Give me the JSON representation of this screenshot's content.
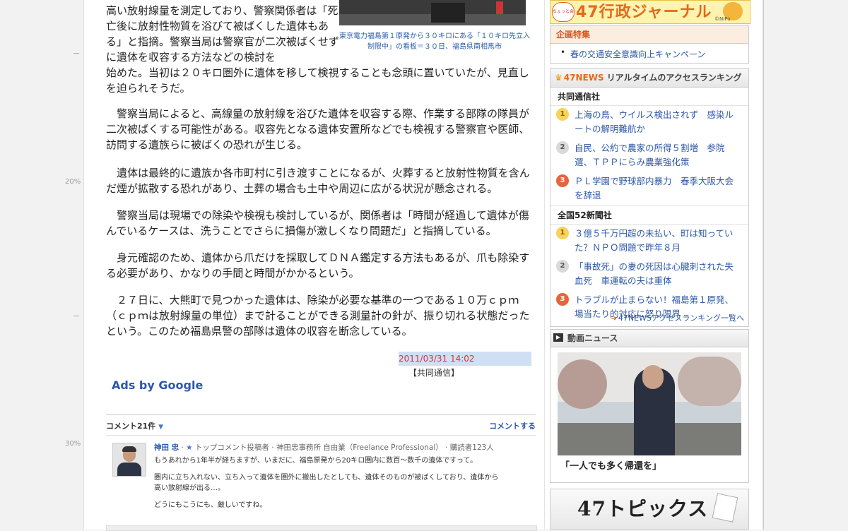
{
  "scroll_markers": {
    "m20": "20%",
    "m30": "30%"
  },
  "article": {
    "p1": "高い放射線量を測定しており、警察関係者は「死亡後に放射性物質を浴びて被ばくした遺体もある」と指摘。警察当局は警察官が二次被ばくせずに遺体を収容する方法などの検討を",
    "p1b": "始めた。当初は２０キロ圏外に遺体を移して検視することも念頭に置いていたが、見直しを迫られそうだ。",
    "p2": "警察当局によると、高線量の放射線を浴びた遺体を収容する際、作業する部隊の隊員が二次被ばくする可能性がある。収容先となる遺体安置所などでも検視する警察官や医師、訪問する遺族らに被ばくの恐れが生じる。",
    "p3": "遺体は最終的に遺族か各市町村に引き渡すことになるが、火葬すると放射性物質を含んだ煙が拡散する恐れがあり、土葬の場合も土中や周辺に広がる状況が懸念される。",
    "p4": "警察当局は現場での除染や検視も検討しているが、関係者は「時間が経過して遺体が傷んでいるケースは、洗うことでさらに損傷が激しくなり問題だ」と指摘している。",
    "p5": "身元確認のため、遺体から爪だけを採取してＤＮＡ鑑定する方法もあるが、爪も除染する必要があり、かなりの手間と時間がかかるという。",
    "p6": "２７日に、大熊町で見つかった遺体は、除染が必要な基準の一つである１０万ｃｐｍ（ｃｐｍは放射線量の単位）まで計ることができる測量計の針が、振り切れる状態だったという。このため福島県警の部隊は遺体の収容を断念している。",
    "photo_caption": "東京電力福島第１原発から３０キロにある「１０キロ先立入制限中」の看板＝３０日、福島県南相馬市",
    "date": "2011/03/31 14:02",
    "source": "【共同通信】"
  },
  "ads": {
    "label": "Ads by Google"
  },
  "comments": {
    "count_label": "コメント21件",
    "post_link": "コメントする",
    "items": [
      {
        "name": "神田 忠",
        "meta": "トップコメント投稿者 · 神田忠事務所 自由業（Freelance Professional） · 購読者123人",
        "line1": "もうあれから1年半が経ちますが、いまだに、福島原発から20キロ圏内に数百〜数千の遺体ですって。",
        "line2": "圏内に立ち入れない、立ち入って遺体を圏外に搬出したとしても、遺体そのものが被ばくしており、遺体から",
        "line3": "高い放射線が出る…。",
        "line4": "どうにもこうにも、厳しいですね。"
      }
    ]
  },
  "sidebar": {
    "banner": {
      "badge": "ちょっと会社",
      "title": "47行政ジャーナル",
      "nipo": "©NIPo"
    },
    "feature": {
      "title": "企画特集",
      "items": [
        "春の交通安全意識向上キャンペーン"
      ]
    },
    "ranking": {
      "brand": "47NEWS",
      "title": "リアルタイムのアクセスランキング",
      "sections": [
        {
          "name": "共同通信社",
          "items": [
            "上海の鳥、ウイルス検出されず　感染ルートの解明難航か",
            "自民、公約で農家の所得５割増　参院選、ＴＰＰにらみ農業強化策",
            "ＰＬ学園で野球部内暴力　春季大阪大会を辞退"
          ]
        },
        {
          "name": "全国52新聞社",
          "items": [
            "３億５千万円超の未払い、町は知っていた？ＮＰＯ問題で昨年８月",
            "「事故死」の妻の死因は心臓刺された失血死　車運転の夫は重体",
            "トラブルが止まらない！福島第１原発、場当たり的対応に怒り限界"
          ]
        }
      ],
      "more": "47NEWSアクセスランキング一覧へ"
    },
    "video": {
      "title": "動画ニュース",
      "caption": "「一人でも多く帰還を」"
    },
    "topics": {
      "title": "47トピックス"
    }
  }
}
